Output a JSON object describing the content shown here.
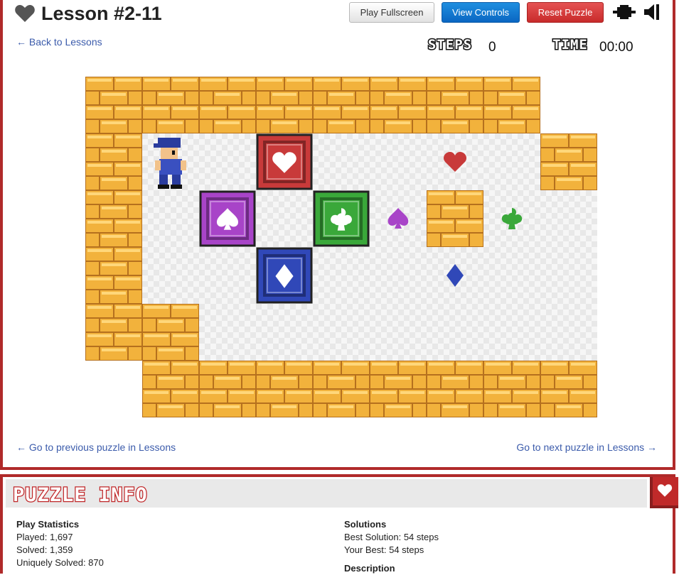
{
  "header": {
    "title": "Lesson #2-11",
    "back_link": "← Back to Lessons"
  },
  "toolbar": {
    "fullscreen_label": "Play Fullscreen",
    "controls_label": "View Controls",
    "reset_label": "Reset Puzzle"
  },
  "stats_bar": {
    "steps_label": "STEPS",
    "steps_value": "0",
    "time_label": "TIME",
    "time_value": "00:00"
  },
  "board": {
    "tiles": [
      "WWWWWWWW##",
      "WFFFFFFFWW",
      "WFFFFFWFFW",
      "WFFFFFFFFW",
      "WWFFFFFFFW",
      "#WWWWWWWWW"
    ],
    "player": {
      "row": 1,
      "col": 1
    },
    "boxes": [
      {
        "row": 1,
        "col": 3,
        "suit": "heart",
        "color": "#c83a3a"
      },
      {
        "row": 2,
        "col": 2,
        "suit": "spade",
        "color": "#a844c8"
      },
      {
        "row": 2,
        "col": 4,
        "suit": "club",
        "color": "#3aa83a"
      },
      {
        "row": 3,
        "col": 3,
        "suit": "diamond",
        "color": "#3048b8"
      }
    ],
    "targets": [
      {
        "row": 1,
        "col": 6,
        "suit": "heart",
        "color": "#c83a3a"
      },
      {
        "row": 2,
        "col": 5,
        "suit": "spade",
        "color": "#a844c8"
      },
      {
        "row": 2,
        "col": 7,
        "suit": "club",
        "color": "#3aa83a"
      },
      {
        "row": 3,
        "col": 6,
        "suit": "diamond",
        "color": "#3048b8"
      }
    ]
  },
  "nav": {
    "prev": "← Go to previous puzzle in Lessons",
    "next": "Go to next puzzle in Lessons →"
  },
  "info": {
    "title": "PUZZLE INFO",
    "play_stats_heading": "Play Statistics",
    "played": "Played: 1,697",
    "solved": "Solved: 1,359",
    "uniquely_solved": "Uniquely Solved: 870",
    "solutions_heading": "Solutions",
    "best_solution": "Best Solution: 54 steps",
    "your_best": "Your Best: 54 steps",
    "description_heading": "Description"
  },
  "colors": {
    "accent_red": "#b02a2a",
    "brick": "#e8a93a",
    "mortar": "#b5701e"
  }
}
